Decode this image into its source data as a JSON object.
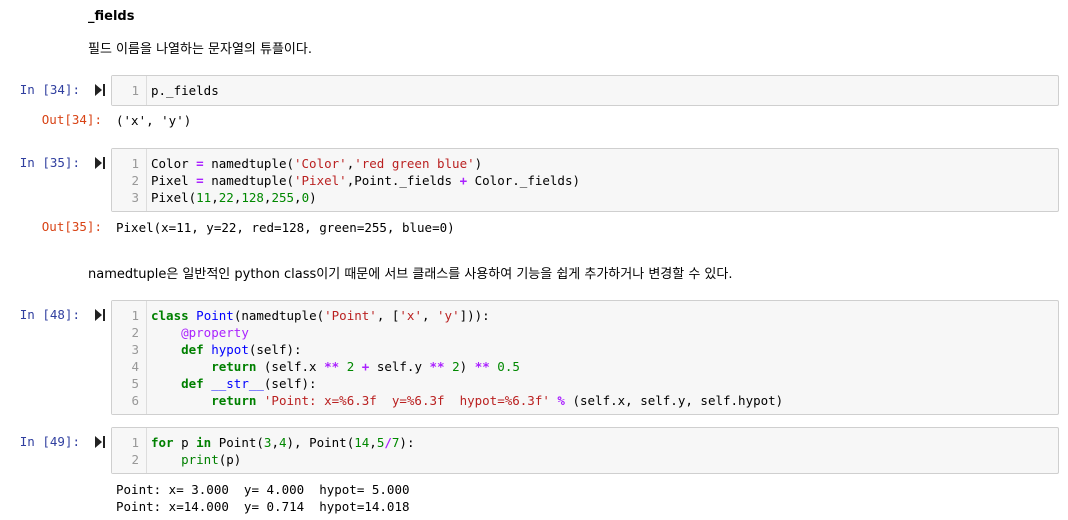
{
  "markdown1": {
    "heading": "_fields",
    "text": "필드 이름을 나열하는 문자열의 튜플이다."
  },
  "cells": [
    {
      "in_prompt": "In [34]:",
      "out_prompt": "Out[34]:",
      "lines": [
        "1",
        "p._fields"
      ],
      "output": "('x', 'y')"
    },
    {
      "in_prompt": "In [35]:",
      "out_prompt": "Out[35]:",
      "lines": [
        "Color = namedtuple('Color','red green blue')",
        "Pixel = namedtuple('Pixel',Point._fields + Color._fields)",
        "Pixel(11,22,128,255,0)"
      ],
      "output": "Pixel(x=11, y=22, red=128, green=255, blue=0)"
    },
    {
      "in_prompt": "In [48]:",
      "lines": [
        "class Point(namedtuple('Point', ['x', 'y'])):",
        "    @property",
        "    def hypot(self):",
        "        return (self.x ** 2 + self.y ** 2) ** 0.5",
        "    def __str__(self):",
        "        return 'Point: x=%6.3f  y=%6.3f  hypot=%6.3f' % (self.x, self.y, self.hypot)"
      ]
    },
    {
      "in_prompt": "In [49]:",
      "lines": [
        "for p in Point(3,4), Point(14,5/7):",
        "    print(p)"
      ],
      "output_lines": [
        "Point: x= 3.000  y= 4.000  hypot= 5.000",
        "Point: x=14.000  y= 0.714  hypot=14.018"
      ]
    }
  ],
  "markdown2": {
    "text": "namedtuple은 일반적인 python class이기 때문에 서브 클래스를 사용하여 기능을 쉽게 추가하거나 변경할 수 있다."
  },
  "line_numbers": [
    "1",
    "2",
    "3",
    "4",
    "5",
    "6"
  ],
  "icons": {
    "run": "run-cell-icon"
  },
  "colors": {
    "in_prompt": "#303f9f",
    "out_prompt": "#d84315",
    "keyword": "#008000",
    "string": "#ba2121"
  }
}
